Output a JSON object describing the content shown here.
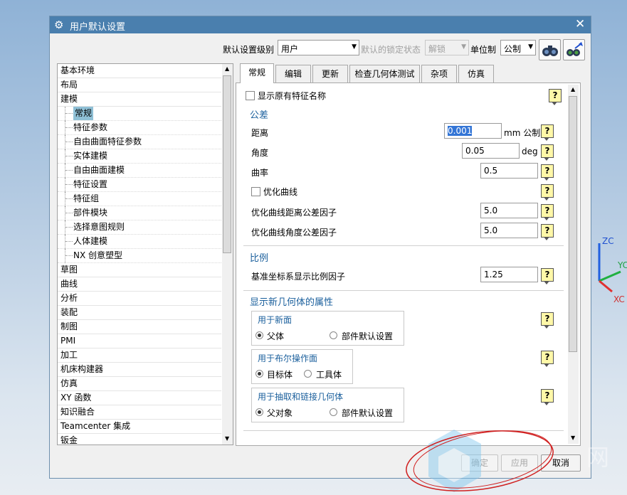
{
  "dialog": {
    "title": "用户默认设置",
    "close": "✕"
  },
  "toolbar": {
    "level_label": "默认设置级别",
    "level_value": "用户",
    "lock_label": "默认的锁定状态",
    "lock_value": "解锁",
    "units_label": "单位制",
    "units_value": "公制"
  },
  "tree": [
    {
      "label": "基本环境",
      "level": 0
    },
    {
      "label": "布局",
      "level": 0
    },
    {
      "label": "建模",
      "level": 0
    },
    {
      "label": "常规",
      "level": 1,
      "selected": true
    },
    {
      "label": "特征参数",
      "level": 1
    },
    {
      "label": "自由曲面特征参数",
      "level": 1
    },
    {
      "label": "实体建模",
      "level": 1
    },
    {
      "label": "自由曲面建模",
      "level": 1
    },
    {
      "label": "特征设置",
      "level": 1
    },
    {
      "label": "特征组",
      "level": 1
    },
    {
      "label": "部件模块",
      "level": 1
    },
    {
      "label": "选择意图规则",
      "level": 1
    },
    {
      "label": "人体建模",
      "level": 1
    },
    {
      "label": "NX 创意塑型",
      "level": 1
    },
    {
      "label": "草图",
      "level": 0
    },
    {
      "label": "曲线",
      "level": 0
    },
    {
      "label": "分析",
      "level": 0
    },
    {
      "label": "装配",
      "level": 0
    },
    {
      "label": "制图",
      "level": 0
    },
    {
      "label": "PMI",
      "level": 0
    },
    {
      "label": "加工",
      "level": 0
    },
    {
      "label": "机床构建器",
      "level": 0
    },
    {
      "label": "仿真",
      "level": 0
    },
    {
      "label": "XY 函数",
      "level": 0
    },
    {
      "label": "知识融合",
      "level": 0
    },
    {
      "label": "Teamcenter 集成",
      "level": 0
    },
    {
      "label": "钣金",
      "level": 0
    }
  ],
  "tabs": [
    "常规",
    "编辑",
    "更新",
    "检查几何体测试",
    "杂项",
    "仿真"
  ],
  "general": {
    "show_feature_names": "显示原有特征名称",
    "tolerance_title": "公差",
    "distance_label": "距离",
    "distance_value": "0.001",
    "distance_unit": "mm 公制",
    "angle_label": "角度",
    "angle_value": "0.05",
    "angle_unit": "deg",
    "curvature_label": "曲率",
    "curvature_value": "0.5",
    "optimize_curve": "优化曲线",
    "opt_dist_label": "优化曲线距离公差因子",
    "opt_dist_value": "5.0",
    "opt_angle_label": "优化曲线角度公差因子",
    "opt_angle_value": "5.0",
    "scale_title": "比例",
    "csys_scale_label": "基准坐标系显示比例因子",
    "csys_scale_value": "1.25",
    "newgeom_title": "显示新几何体的属性",
    "new_face_group": "用于新面",
    "new_face_opt1": "父体",
    "new_face_opt2": "部件默认设置",
    "bool_group": "用于布尔操作面",
    "bool_opt1": "目标体",
    "bool_opt2": "工具体",
    "extract_group": "用于抽取和链接几何体",
    "extract_opt1": "父对象",
    "extract_opt2": "部件默认设置",
    "help": "?"
  },
  "buttons": {
    "ok": "确定",
    "apply": "应用",
    "cancel": "取消"
  },
  "axes": {
    "zc": "ZC",
    "yc": "YC",
    "xc": "XC"
  },
  "watermark": "网",
  "colors": {
    "titlebar": "#4a7fae",
    "section": "#1a5f9c",
    "selection": "#8fc0d6",
    "help_bg": "#fff8a8"
  }
}
